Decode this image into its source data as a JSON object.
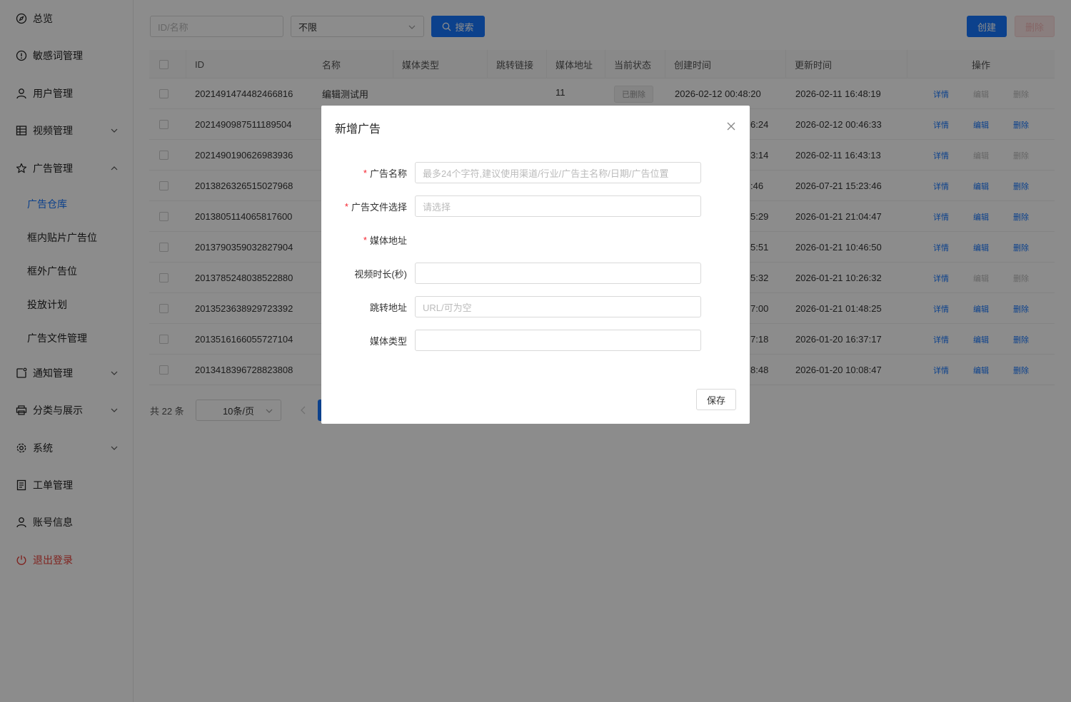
{
  "sidebar": {
    "items": [
      {
        "label": "总览"
      },
      {
        "label": "敏感词管理"
      },
      {
        "label": "用户管理"
      },
      {
        "label": "视频管理"
      },
      {
        "label": "广告管理"
      },
      {
        "label": "通知管理"
      },
      {
        "label": "分类与展示"
      },
      {
        "label": "系统"
      },
      {
        "label": "工单管理"
      },
      {
        "label": "账号信息"
      },
      {
        "label": "退出登录"
      }
    ],
    "sub_items": [
      {
        "label": "广告仓库"
      },
      {
        "label": "框内贴片广告位"
      },
      {
        "label": "框外广告位"
      },
      {
        "label": "投放计划"
      },
      {
        "label": "广告文件管理"
      }
    ]
  },
  "toolbar": {
    "search_placeholder": "ID/名称",
    "filter_value": "不限",
    "search_label": "搜索",
    "create_label": "创建",
    "delete_label": "删除"
  },
  "table": {
    "headers": [
      "ID",
      "名称",
      "媒体类型",
      "跳转链接",
      "媒体地址",
      "当前状态",
      "创建时间",
      "更新时间",
      "操作"
    ],
    "rows": [
      {
        "id": "2021491474482466816",
        "name": "编辑测试用",
        "media": "11",
        "status": "已删除",
        "created": "2026-02-12 00:48:20",
        "updated": "2026-02-11 16:48:19",
        "detail": "详情",
        "edit": "编辑",
        "del": "删除"
      },
      {
        "id": "2021490987511189504",
        "name": "",
        "media": "",
        "status": "",
        "created": "6:24",
        "updated": "2026-02-12 00:46:33",
        "detail": "详情",
        "edit": "编辑",
        "del": "删除"
      },
      {
        "id": "2021490190626983936",
        "name": "",
        "media": "",
        "status": "",
        "created": "3:14",
        "updated": "2026-02-11 16:43:13",
        "detail": "详情",
        "edit": "编辑",
        "del": "删除"
      },
      {
        "id": "2013826326515027968",
        "name": "",
        "media": "",
        "status": "",
        "created": ":46",
        "updated": "2026-07-21 15:23:46",
        "detail": "详情",
        "edit": "编辑",
        "del": "删除"
      },
      {
        "id": "2013805114065817600",
        "name": "",
        "media": "",
        "status": "",
        "created": "5:29",
        "updated": "2026-01-21 21:04:47",
        "detail": "详情",
        "edit": "编辑",
        "del": "删除"
      },
      {
        "id": "2013790359032827904",
        "name": "",
        "media": "",
        "status": "",
        "created": "5:51",
        "updated": "2026-01-21 10:46:50",
        "detail": "详情",
        "edit": "编辑",
        "del": "删除"
      },
      {
        "id": "2013785248038522880",
        "name": "",
        "media": "",
        "status": "",
        "created": "5:32",
        "updated": "2026-01-21 10:26:32",
        "detail": "详情",
        "edit": "编辑",
        "del": "删除"
      },
      {
        "id": "2013523638929723392",
        "name": "",
        "media": "",
        "status": "",
        "created": "7:00",
        "updated": "2026-01-21 01:48:25",
        "detail": "详情",
        "edit": "编辑",
        "del": "删除"
      },
      {
        "id": "2013516166055727104",
        "name": "",
        "media": "",
        "status": "",
        "created": "7:18",
        "updated": "2026-01-20 16:37:17",
        "detail": "详情",
        "edit": "编辑",
        "del": "删除"
      },
      {
        "id": "2013418396728823808",
        "name": "",
        "media": "",
        "status": "",
        "created": "8:48",
        "updated": "2026-01-20 10:08:47",
        "detail": "详情",
        "edit": "编辑",
        "del": "删除"
      }
    ]
  },
  "pagination": {
    "total": "共 22 条",
    "page_size": "10条/页"
  },
  "modal": {
    "title": "新增广告",
    "fields": [
      {
        "label": "广告名称",
        "placeholder": "最多24个字符,建议使用渠道/行业/广告主名称/日期/广告位置"
      },
      {
        "label": "广告文件选择",
        "placeholder": "请选择"
      },
      {
        "label": "媒体地址",
        "placeholder": ""
      },
      {
        "label": "视频时长(秒)",
        "placeholder": ""
      },
      {
        "label": "跳转地址",
        "placeholder": "URL/可为空"
      },
      {
        "label": "媒体类型",
        "placeholder": ""
      }
    ],
    "save_label": "保存"
  },
  "colors": {
    "primary": "#1677ff",
    "danger": "#e8413a"
  }
}
